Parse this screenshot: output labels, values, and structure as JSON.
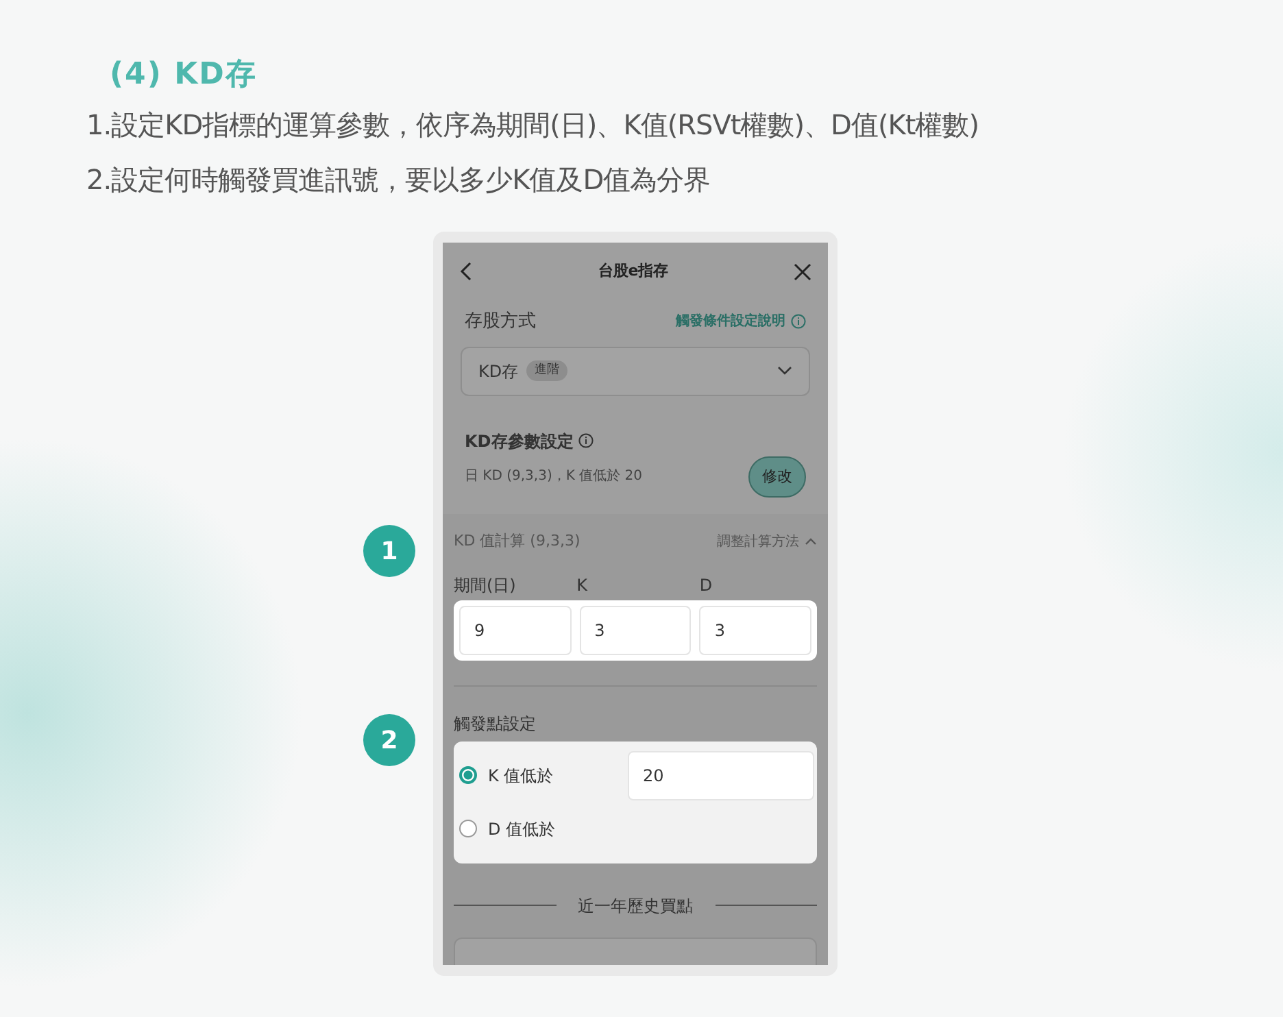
{
  "heading": "(4) KD存",
  "lines": [
    "1.設定KD指標的運算參數，依序為期間(日)、K值(RSVt權數)、D值(Kt權數)",
    "2.設定何時觸發買進訊號，要以多少K值及D值為分界"
  ],
  "callouts": [
    "1",
    "2"
  ],
  "phone": {
    "title": "台股e指存",
    "method_label": "存股方式",
    "help_link": "觸發條件設定說明",
    "select_value": "KD存",
    "select_tag": "進階",
    "params_title": "KD存參數設定",
    "params_summary": "日 KD (9,3,3)，K 值低於 20",
    "edit_button": "修改",
    "calc_title": "KD 值計算 (9,3,3)",
    "adjust_link": "調整計算方法",
    "fields": [
      {
        "label": "期間(日)",
        "value": "9"
      },
      {
        "label": "K",
        "value": "3"
      },
      {
        "label": "D",
        "value": "3"
      }
    ],
    "trigger_title": "觸發點設定",
    "options": [
      {
        "label": "K 值低於",
        "selected": true,
        "value": "20"
      },
      {
        "label": "D 值低於",
        "selected": false
      }
    ],
    "history_title": "近一年歷史買點"
  }
}
